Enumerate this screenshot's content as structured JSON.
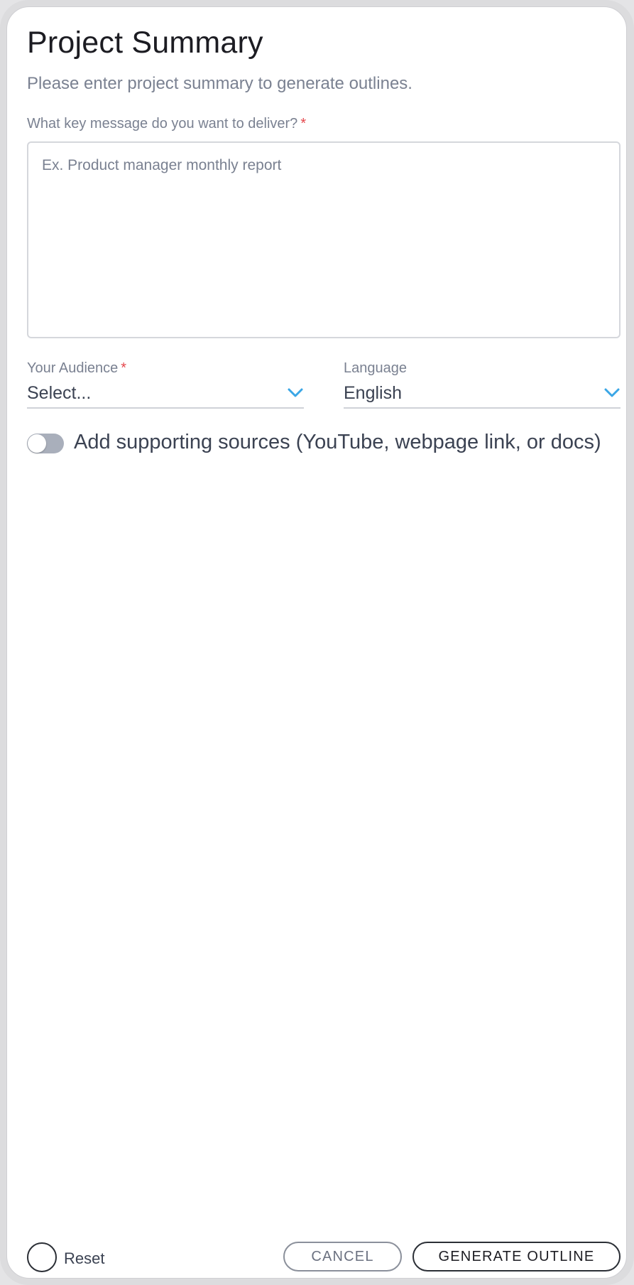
{
  "header": {
    "title": "Project Summary",
    "subtitle": "Please enter project summary to generate outlines."
  },
  "key_message": {
    "label": "What key message do you want to deliver?",
    "required_mark": "*",
    "value": "",
    "placeholder": "Ex. Product manager monthly report"
  },
  "audience": {
    "label": "Your Audience",
    "required_mark": "*",
    "value": "Select..."
  },
  "language": {
    "label": "Language",
    "value": "English"
  },
  "sources_toggle": {
    "label": "Add supporting sources (YouTube, webpage link, or docs)",
    "enabled": false
  },
  "footer": {
    "reset_label": "Reset",
    "cancel_label": "CANCEL",
    "generate_label": "GENERATE OUTLINE"
  },
  "colors": {
    "accent": "#3aa6e6",
    "required": "#e5484d",
    "toggle_off": "#a9afbb"
  },
  "icons": {
    "select_chevron": "chevron-down-icon",
    "reset": "circle-icon"
  }
}
